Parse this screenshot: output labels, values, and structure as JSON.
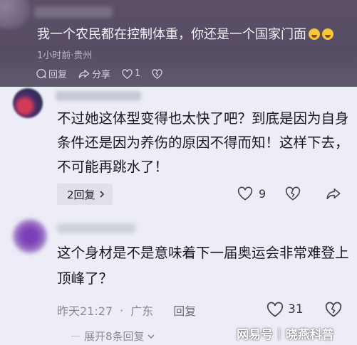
{
  "top_comment": {
    "text": "我一个农民都在控制体重，你还是一个国家门面",
    "meta": "1小时前·贵州",
    "reply_label": "回复",
    "share_label": "分享",
    "like_count": "1",
    "emoji_icons": [
      "laugh-cry-emoji",
      "laugh-cry-emoji"
    ]
  },
  "comment1": {
    "text": "不过她这体型变得也太快了吧？到底是因为自身条件还是因为养伤的原因不得而知！这样下去，不可能再跳水了！",
    "replies_label": "2回复",
    "like_count": "9"
  },
  "comment2": {
    "text": "这个身材是不是意味着下一届奥运会非常难登上顶峰了？",
    "time": "昨天21:27",
    "location": "广东",
    "reply_label": "回复",
    "like_count": "31",
    "expand_label": "展开8条回复"
  },
  "watermark": {
    "brand": "网易号",
    "separator": "|",
    "author": "晓燕科普"
  },
  "colors": {
    "page_bg": "#ecedf6",
    "top_card_bg": "#5b5068",
    "text_primary": "#17171d",
    "text_muted": "#8b8b95"
  }
}
